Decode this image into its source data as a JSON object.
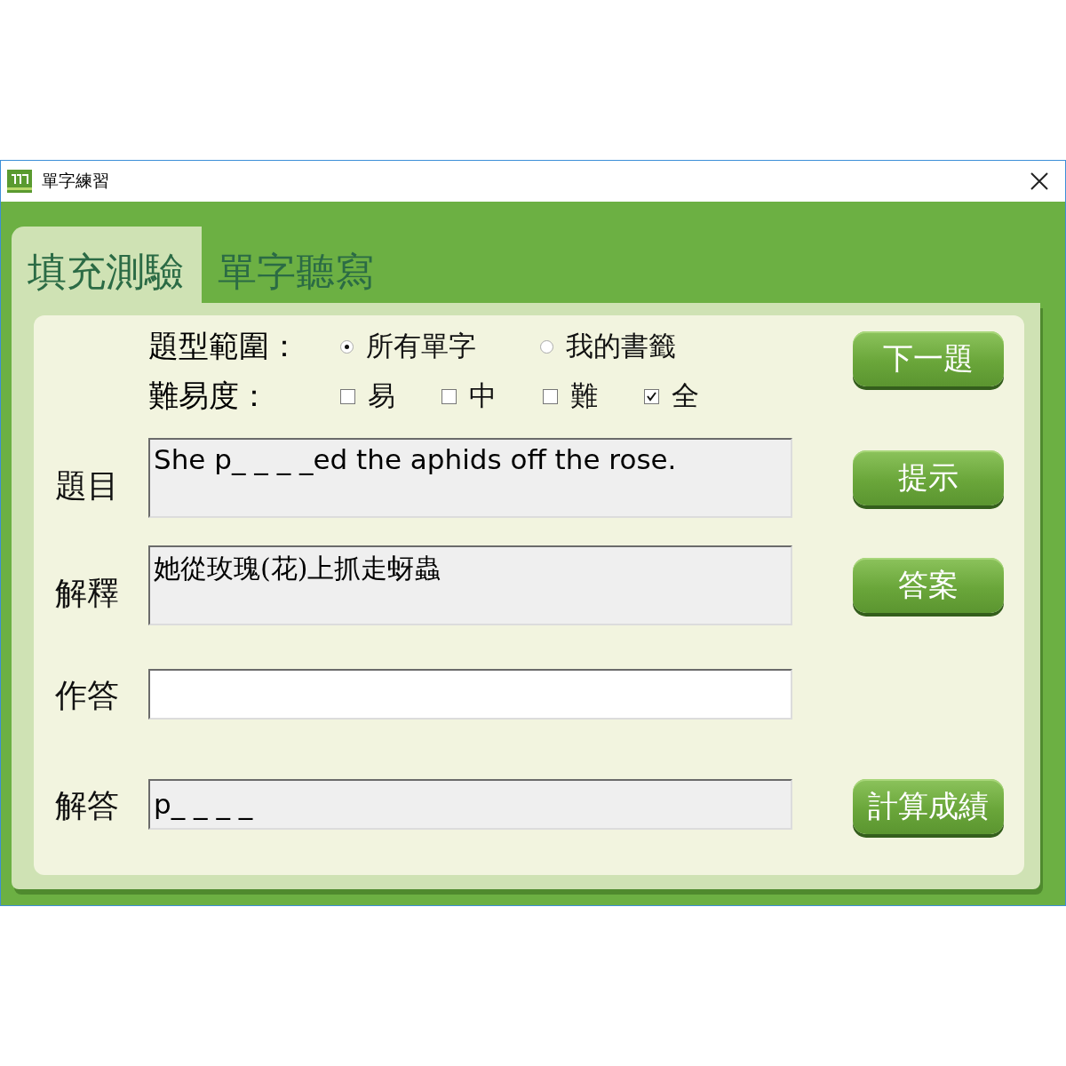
{
  "window": {
    "title": "單字練習"
  },
  "tabs": [
    {
      "label": "填充測驗",
      "selected": true
    },
    {
      "label": "單字聽寫",
      "selected": false
    }
  ],
  "scope": {
    "label": "題型範圍：",
    "options": [
      {
        "label": "所有單字",
        "selected": true
      },
      {
        "label": "我的書籤",
        "selected": false
      }
    ]
  },
  "difficulty": {
    "label": "難易度：",
    "options": [
      {
        "label": "易",
        "checked": false
      },
      {
        "label": "中",
        "checked": false
      },
      {
        "label": "難",
        "checked": false
      },
      {
        "label": "全",
        "checked": true
      }
    ]
  },
  "next_button": "下一題",
  "fields": [
    {
      "label": "題目",
      "kind": "readonly",
      "value": "She p_ _ _ _ed the aphids off the rose.",
      "button": "提示"
    },
    {
      "label": "解釋",
      "kind": "readonly_serif",
      "value": "她從玫瑰(花)上抓走蚜蟲",
      "button": "答案"
    },
    {
      "label": "作答",
      "kind": "input"
    },
    {
      "label": "解答",
      "kind": "readonly_short",
      "value": "p_ _ _ _",
      "button": "計算成績"
    }
  ]
}
